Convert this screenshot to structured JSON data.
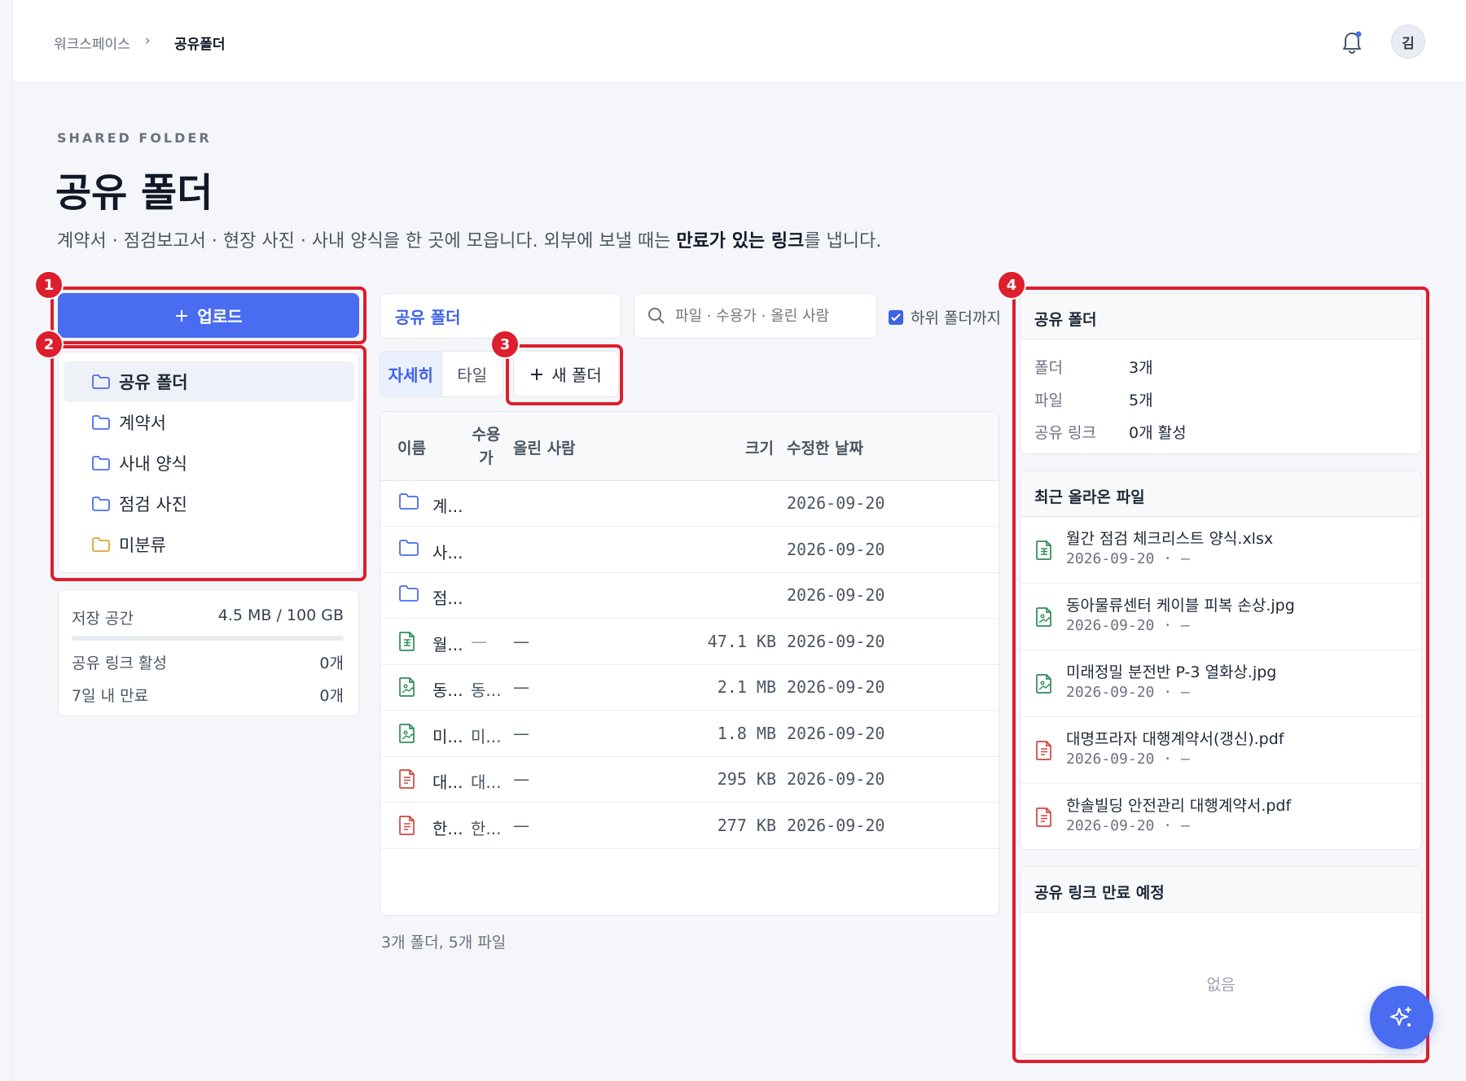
{
  "breadcrumb": {
    "root": "워크스페이스",
    "separator": "›",
    "current": "공유폴더"
  },
  "user": {
    "avatar_initial": "김"
  },
  "header": {
    "eyebrow": "SHARED FOLDER",
    "title": "공유 폴더",
    "description_prefix": "계약서 · 점검보고서 · 현장 사진 · 사내 양식을 한 곳에 모읍니다. 외부에 보낼 때는 ",
    "description_bold": "만료가 있는 링크",
    "description_suffix": "를 냅니다."
  },
  "annotations": {
    "b1": "1",
    "b2": "2",
    "b3": "3",
    "b4": "4"
  },
  "sidebar": {
    "upload_label": "업로드",
    "folders": [
      {
        "label": "공유 폴더",
        "active": true,
        "color": "#4a6cf0"
      },
      {
        "label": "계약서",
        "active": false,
        "color": "#4a6cf0"
      },
      {
        "label": "사내 양식",
        "active": false,
        "color": "#4a6cf0"
      },
      {
        "label": "점검 사진",
        "active": false,
        "color": "#4a6cf0"
      },
      {
        "label": "미분류",
        "active": false,
        "color": "#e0a235"
      }
    ],
    "storage": {
      "label": "저장 공간",
      "value": "4.5 MB / 100 GB",
      "usage_fraction": 4.5e-05,
      "active_links_label": "공유 링크 활성",
      "active_links_value": "0개",
      "expiring_label": "7일 내 만료",
      "expiring_value": "0개"
    }
  },
  "toolbar": {
    "path": "공유 폴더",
    "search_placeholder": "파일 · 수용가 · 올린 사람",
    "include_subfolders_label": "하위 폴더까지",
    "include_subfolders_checked": true,
    "view_detail": "자세히",
    "view_tile": "타일",
    "new_folder": "새 폴더"
  },
  "table": {
    "headers": {
      "name": "이름",
      "client": "수용가",
      "uploader": "올린 사람",
      "size": "크기",
      "modified": "수정한 날짜"
    },
    "rows": [
      {
        "type": "folder",
        "name": "계...",
        "client": "",
        "uploader": "",
        "size": "",
        "date": "2026-09-20"
      },
      {
        "type": "folder",
        "name": "사...",
        "client": "",
        "uploader": "",
        "size": "",
        "date": "2026-09-20"
      },
      {
        "type": "folder",
        "name": "점...",
        "client": "",
        "uploader": "",
        "size": "",
        "date": "2026-09-20"
      },
      {
        "type": "sheet",
        "name": "월...",
        "client": "—",
        "uploader": "—",
        "size": "47.1 KB",
        "date": "2026-09-20"
      },
      {
        "type": "image",
        "name": "동...",
        "client": "동...",
        "uploader": "—",
        "size": "2.1 MB",
        "date": "2026-09-20"
      },
      {
        "type": "image",
        "name": "미...",
        "client": "미...",
        "uploader": "—",
        "size": "1.8 MB",
        "date": "2026-09-20"
      },
      {
        "type": "pdf",
        "name": "대...",
        "client": "대...",
        "uploader": "—",
        "size": "295 KB",
        "date": "2026-09-20"
      },
      {
        "type": "pdf",
        "name": "한...",
        "client": "한...",
        "uploader": "—",
        "size": "277 KB",
        "date": "2026-09-20"
      }
    ],
    "summary": "3개 폴더, 5개 파일"
  },
  "info_panel": {
    "title": "공유 폴더",
    "folders_label": "폴더",
    "folders_value": "3개",
    "files_label": "파일",
    "files_value": "5개",
    "links_label": "공유 링크",
    "links_value": "0개 활성",
    "recent_title": "최근 올라온 파일",
    "recent": [
      {
        "type": "sheet",
        "name": "월간 점검 체크리스트 양식.xlsx",
        "meta": "2026-09-20 · —"
      },
      {
        "type": "image",
        "name": "동아물류센터 케이블 피복 손상.jpg",
        "meta": "2026-09-20 · —"
      },
      {
        "type": "image",
        "name": "미래정밀 분전반 P-3 열화상.jpg",
        "meta": "2026-09-20 · —"
      },
      {
        "type": "pdf",
        "name": "대명프라자 대행계약서(갱신).pdf",
        "meta": "2026-09-20 · —"
      },
      {
        "type": "pdf",
        "name": "한솔빌딩 안전관리 대행계약서.pdf",
        "meta": "2026-09-20 · —"
      }
    ],
    "expiring_title": "공유 링크 만료 예정",
    "expiring_empty": "없음"
  },
  "colors": {
    "accent": "#4a6cf0",
    "annotation": "#dc1e2d",
    "sheet": "#2e8b57",
    "image": "#2e8b57",
    "pdf": "#d0463c",
    "folder": "#4a6cf0",
    "folder_unsorted": "#e0a235"
  }
}
